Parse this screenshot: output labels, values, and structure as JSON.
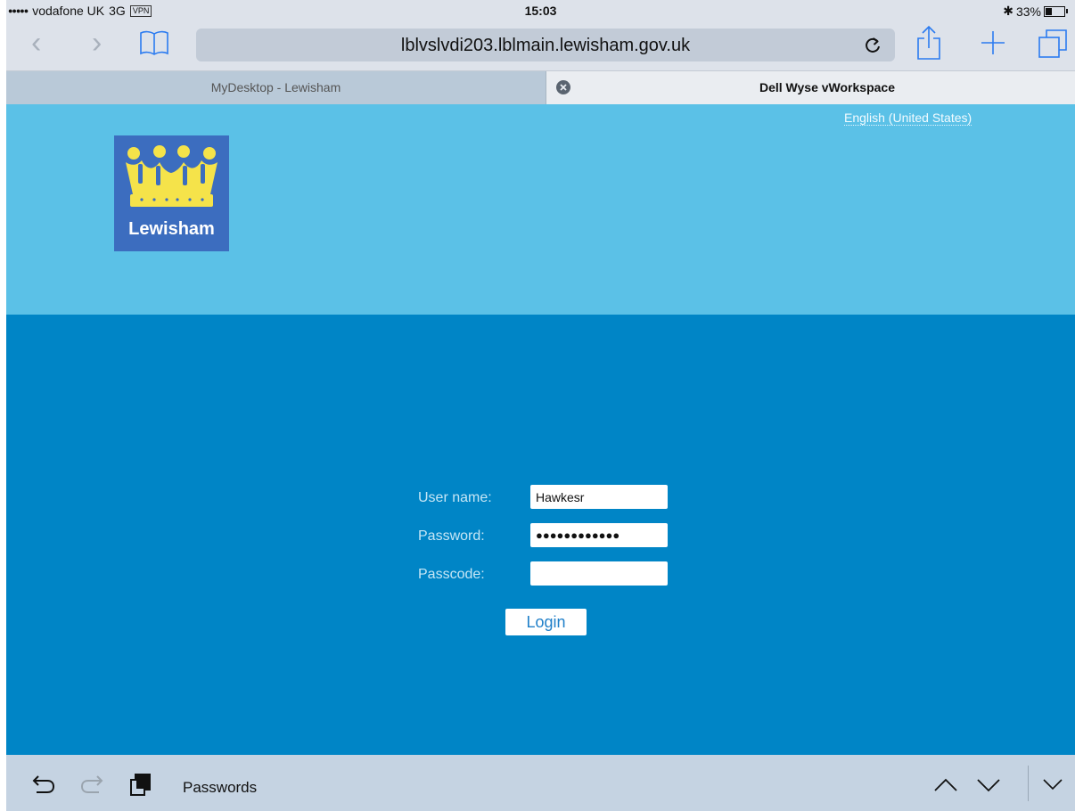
{
  "status_bar": {
    "signal": "●●●●●",
    "carrier": "vodafone UK",
    "network": "3G",
    "vpn": "VPN",
    "time": "15:03",
    "bluetooth": "✱",
    "battery_text": "33%",
    "battery_level_percent": 33
  },
  "toolbar": {
    "url": "lblvslvdi203.lblmain.lewisham.gov.uk",
    "accent_color": "#2b7bf0"
  },
  "tabs": [
    {
      "label": "MyDesktop - Lewisham",
      "active": false
    },
    {
      "label": "Dell Wyse vWorkspace",
      "active": true
    }
  ],
  "page": {
    "language": "English (United States)",
    "logo_text": "Lewisham",
    "form": {
      "username_label": "User name:",
      "username_value": "Hawkesr",
      "password_label": "Password:",
      "password_value": "●●●●●●●●●●●●",
      "passcode_label": "Passcode:",
      "passcode_value": "",
      "login_label": "Login"
    },
    "colors": {
      "header_band": "#5bc1e7",
      "main_band": "#0085c6",
      "logo_bg": "#3c6dbf",
      "crown": "#f5e34a"
    }
  },
  "accessory_bar": {
    "passwords_label": "Passwords"
  }
}
